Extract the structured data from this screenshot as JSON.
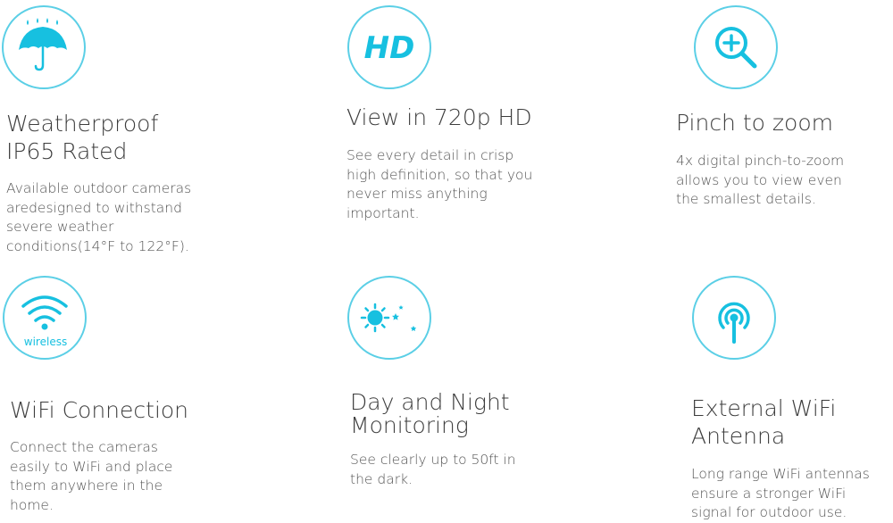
{
  "accent": "#17c0e0",
  "features": [
    {
      "icon": "umbrella-icon",
      "title": "Weatherproof IP65 Rated",
      "description": "Available outdoor cameras aredesigned to withstand severe weather conditions(14°F to 122°F)."
    },
    {
      "icon": "hd-icon",
      "icon_text": "HD",
      "title": "View in 720p HD",
      "description": "See every detail in crisp high definition, so that you never miss anything important."
    },
    {
      "icon": "zoom-in-icon",
      "title": "Pinch to zoom",
      "description": "4x digital pinch-to-zoom allows you to view even the smallest details."
    },
    {
      "icon": "wifi-icon",
      "icon_text": "wireless",
      "title": "WiFi Connection",
      "description": "Connect the cameras easily to WiFi and place them anywhere in the home."
    },
    {
      "icon": "day-night-icon",
      "title": "Day and Night Monitoring",
      "description": "See clearly up to 50ft in the dark."
    },
    {
      "icon": "antenna-icon",
      "title": "External WiFi Antenna",
      "description": "Long range WiFi antennas ensure a stronger WiFi signal for outdoor use."
    }
  ]
}
